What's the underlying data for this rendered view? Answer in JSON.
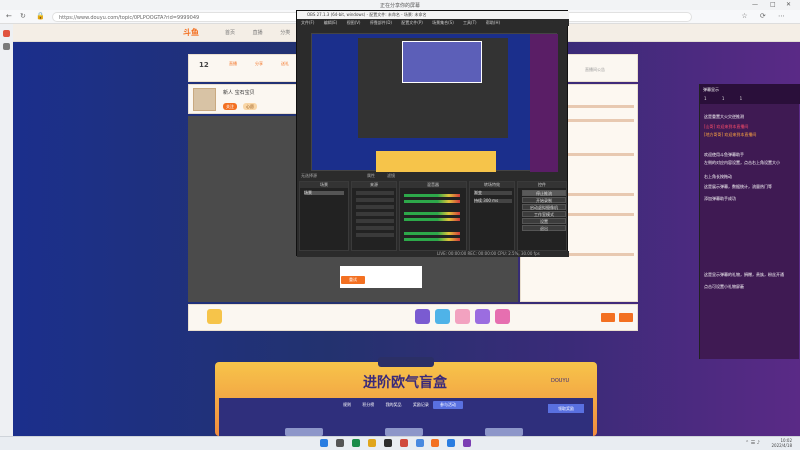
{
  "browser": {
    "window_title": "正在分享你的屏幕",
    "url": "https://www.douyu.com/topic/0PLPOOGTA?rid=9999049",
    "win_controls": [
      "—",
      "□",
      "✕"
    ]
  },
  "site": {
    "logo": "斗鱼",
    "nav": [
      "首页",
      "直播",
      "分类",
      "赛事"
    ],
    "room_number": "12",
    "header_small": [
      "直播",
      "分享",
      "送礼"
    ],
    "anchor_name": "新人 宝石宝贝",
    "tags": [
      "关注",
      "心愿"
    ],
    "top_right": "直播间公告"
  },
  "player": {
    "button_label": "重试"
  },
  "banner": {
    "title": "进阶欧气盲盒",
    "brand": "DOUYU",
    "tabs": [
      "规则",
      "积分榜",
      "我的奖品",
      "奖励记录"
    ],
    "active_tab": "参与活动",
    "right_button": "领取奖励"
  },
  "obs": {
    "title": "OBS 27.1.3 (64-bit, windows) - 配置文件: 未命名 - 场景: 未命名",
    "menu": [
      "文件(F)",
      "编辑(E)",
      "视图(V)",
      "停靠部件(D)",
      "配置文件(P)",
      "场景集合(S)",
      "工具(T)",
      "帮助(H)"
    ],
    "dock_labels": [
      "无选择源",
      "属性",
      "滤镜"
    ],
    "docks": {
      "scenes": "场景",
      "sources": "来源",
      "mixer": "混音器",
      "transitions": "转场特效",
      "controls": "控件"
    },
    "scene_item": "场景",
    "transition_values": [
      "渐变",
      "持续 300 ms"
    ],
    "control_buttons": [
      "停止推流",
      "开始录制",
      "启动虚拟摄像机",
      "工作室模式",
      "设置",
      "退出"
    ],
    "status": "LIVE: 00:00:00  REC: 00:00:00  CPU: 2.5%, 30.00 fps"
  },
  "chat": {
    "header": "弹幕显示",
    "tabs": [
      "1",
      "1",
      "1"
    ],
    "messages": [
      {
        "text": "这是重置大火灾逆推测",
        "cls": ""
      },
      {
        "text": "[山哥] 欢迎来到本直播间",
        "cls": "red"
      },
      {
        "text": "[地方哥哥] 欢迎来到本直播间",
        "cls": "orange"
      },
      {
        "text": "欢迎使用斗鱼弹幕助手",
        "cls": ""
      },
      {
        "text": "左侧的对应内容设置，点击右上角设置大小",
        "cls": ""
      },
      {
        "text": "右上角长按拖动",
        "cls": ""
      },
      {
        "text": "这是展示弹幕，数据统计，流量热门等",
        "cls": ""
      },
      {
        "text": "添加弹幕助手成功",
        "cls": ""
      },
      {
        "text": "这是显示弹幕的礼物，捐赠，贵族，粉丝开通",
        "cls": ""
      },
      {
        "text": "点击可设置小礼物屏蔽",
        "cls": ""
      }
    ]
  },
  "taskbar": {
    "time": "10:02",
    "date": "2022/4/18"
  },
  "colors": {
    "accent": "#f37021",
    "obs_bg": "#2b2b2b",
    "chat_bg": "#3f1a53"
  }
}
